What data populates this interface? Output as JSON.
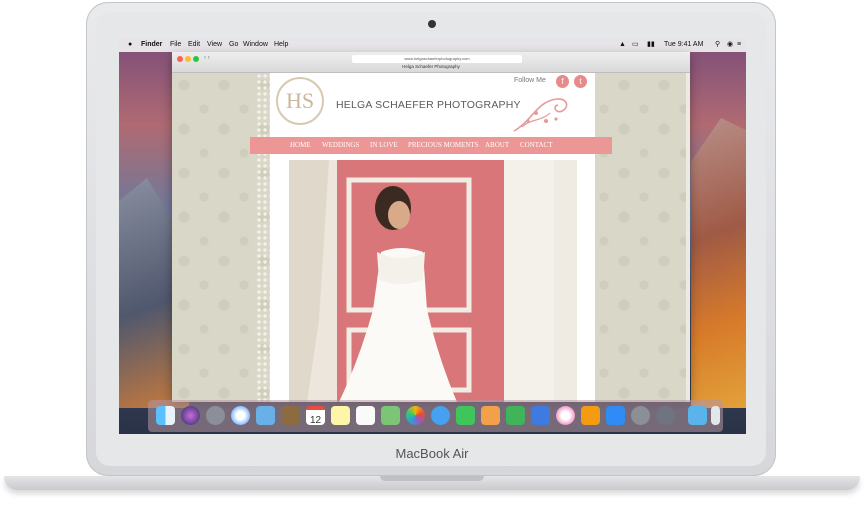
{
  "laptop": {
    "brand": "MacBook Air"
  },
  "menubar": {
    "app": "Finder",
    "menus": [
      "File",
      "Edit",
      "View",
      "Go",
      "Window",
      "Help"
    ],
    "clock": "Tue 9:41 AM"
  },
  "browser": {
    "page_title": "Helga Schaefer Photography",
    "url": "www.helgaschaeferphotography.com"
  },
  "site": {
    "monogram": "HS",
    "name": "HELGA SCHAEFER PHOTOGRAPHY",
    "follow_label": "Follow Me",
    "social": {
      "facebook": "f",
      "twitter": "t"
    },
    "nav": [
      "HOME",
      "WEDDINGS",
      "IN LOVE",
      "PRECIOUS MOMENTS",
      "ABOUT",
      "CONTACT"
    ],
    "colors": {
      "accent": "#ec9696",
      "background": "#d9d7c8",
      "wall": "#d9767a"
    }
  },
  "dock": {
    "calendar_day": "12",
    "apps": [
      "finder-icon",
      "siri-icon",
      "launchpad-icon",
      "safari-icon",
      "mail-icon",
      "notes-icon",
      "calendar-icon",
      "reminders-icon",
      "maps-icon",
      "photos-icon",
      "messages-icon",
      "facetime-icon",
      "pages-icon",
      "numbers-icon",
      "keynote-icon",
      "itunes-icon",
      "ibooks-icon",
      "app-store-icon",
      "system-preferences-icon",
      "unknown-app-icon",
      "folder-icon",
      "trash-icon"
    ]
  }
}
